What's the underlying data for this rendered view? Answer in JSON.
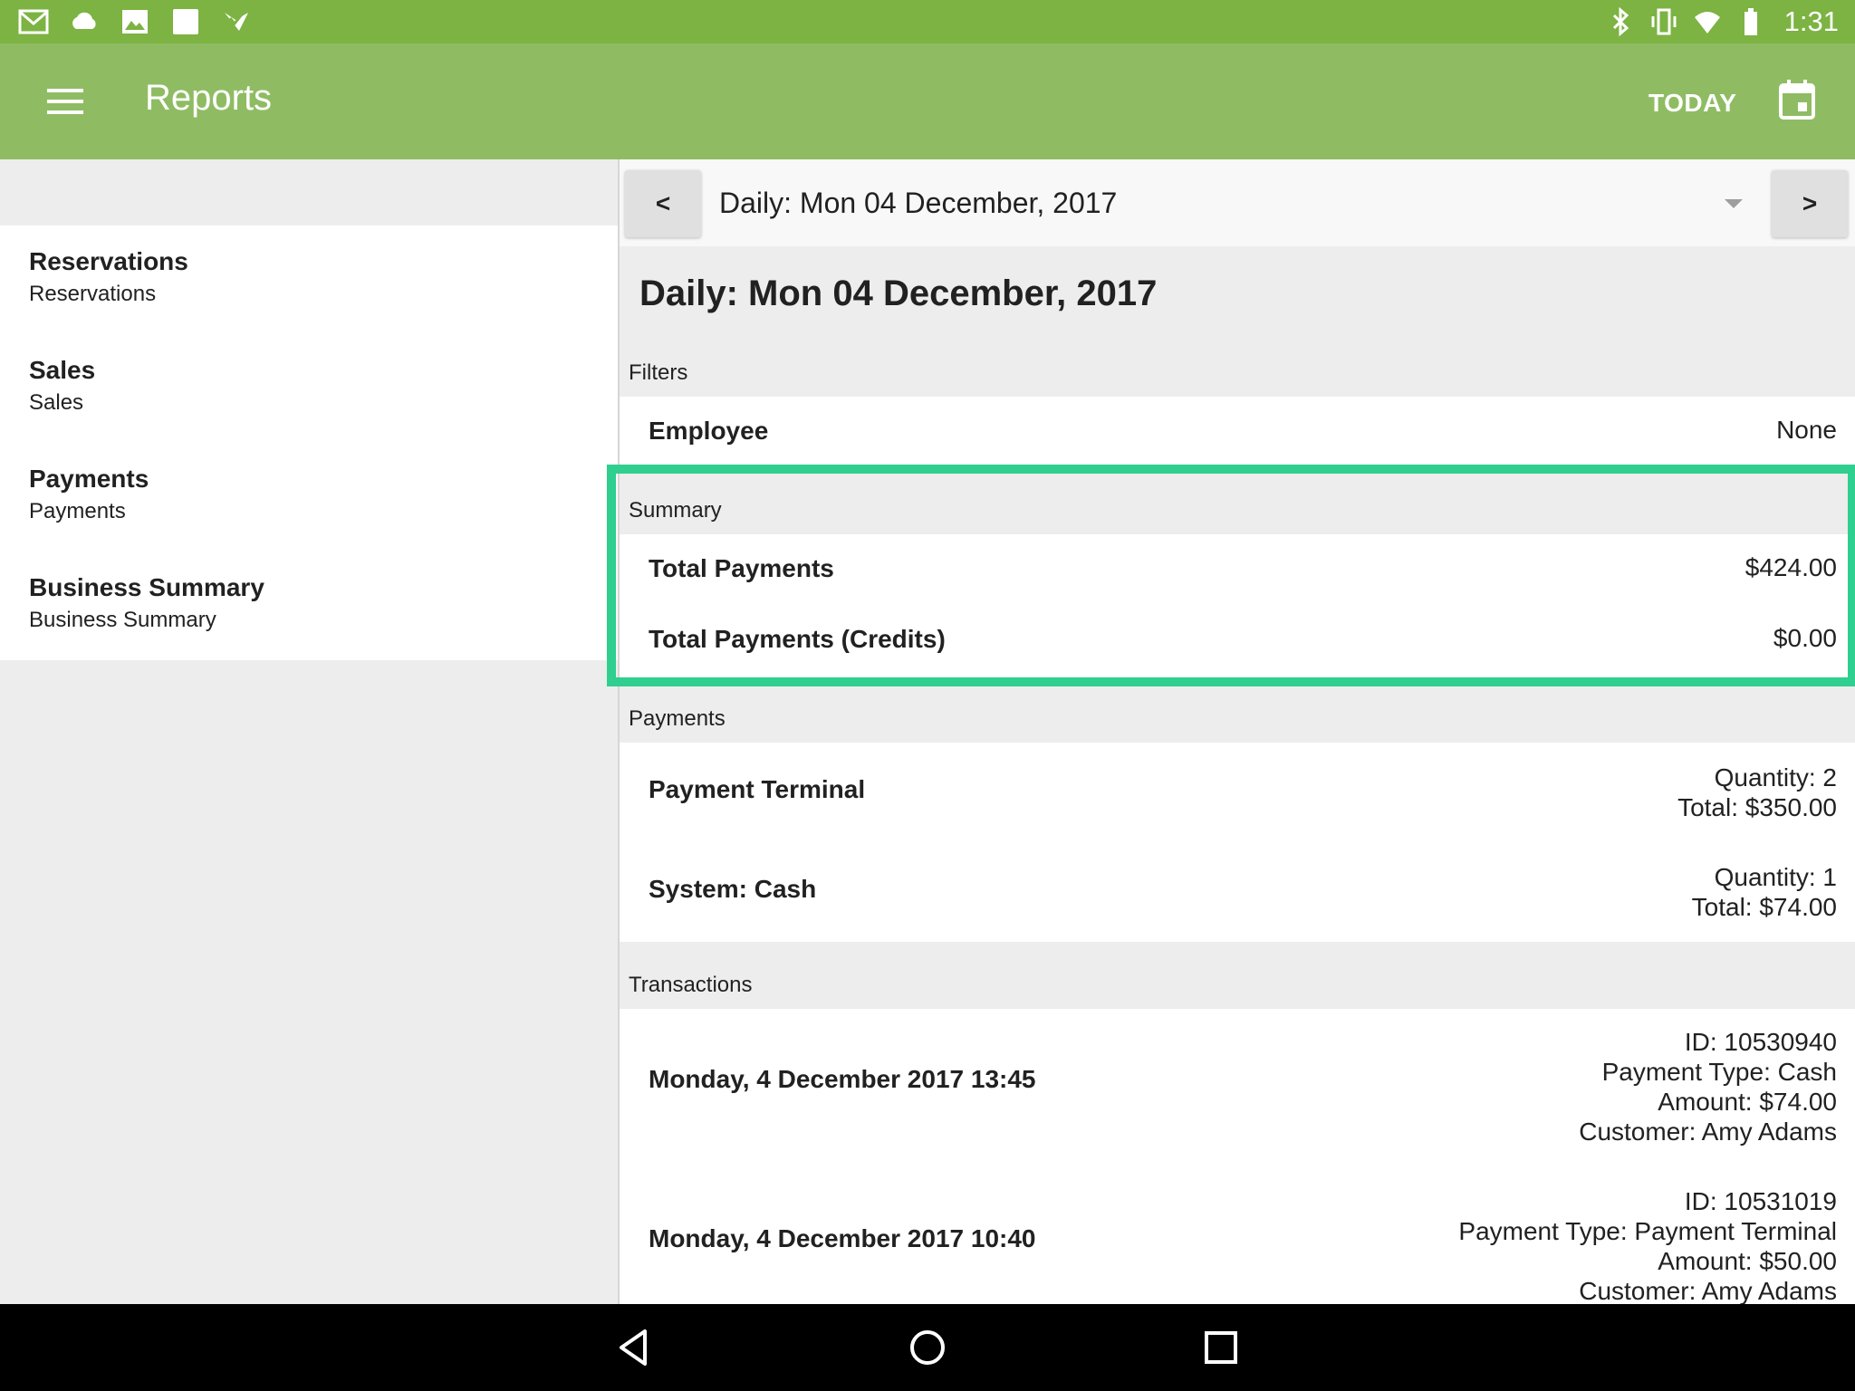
{
  "status_bar": {
    "time": "1:31",
    "left_icons": [
      "gmail-icon",
      "cloud-icon",
      "photo-icon",
      "blank-app-icon",
      "play-games-icon"
    ],
    "right_icons": [
      "bluetooth-icon",
      "vibrate-icon",
      "wifi-icon",
      "battery-icon"
    ]
  },
  "app_bar": {
    "title": "Reports",
    "today_label": "TODAY",
    "colors": {
      "status_bar": "#7cb342",
      "app_bar": "#8fbc63",
      "highlight": "#2ecf8f"
    }
  },
  "sidebar": {
    "items": [
      {
        "title": "Reservations",
        "subtitle": "Reservations"
      },
      {
        "title": "Sales",
        "subtitle": "Sales"
      },
      {
        "title": "Payments",
        "subtitle": "Payments"
      },
      {
        "title": "Business Summary",
        "subtitle": "Business Summary"
      }
    ]
  },
  "date_bar": {
    "prev_label": "<",
    "next_label": ">",
    "selected": "Daily: Mon 04 December, 2017"
  },
  "report": {
    "title": "Daily: Mon 04 December, 2017",
    "filters": {
      "label": "Filters",
      "employee_label": "Employee",
      "employee_value": "None"
    },
    "summary": {
      "label": "Summary",
      "rows": [
        {
          "label": "Total Payments",
          "value": "$424.00"
        },
        {
          "label": "Total Payments (Credits)",
          "value": "$0.00"
        }
      ]
    },
    "payments": {
      "label": "Payments",
      "rows": [
        {
          "label": "Payment Terminal",
          "line1": "Quantity: 2",
          "line2": "Total: $350.00"
        },
        {
          "label": "System: Cash",
          "line1": "Quantity: 1",
          "line2": "Total: $74.00"
        }
      ]
    },
    "transactions": {
      "label": "Transactions",
      "rows": [
        {
          "label": "Monday, 4 December 2017 13:45",
          "id": "ID: 10530940",
          "type": "Payment Type: Cash",
          "amount": "Amount: $74.00",
          "customer": "Customer: Amy Adams"
        },
        {
          "label": "Monday, 4 December 2017 10:40",
          "id": "ID: 10531019",
          "type": "Payment Type: Payment Terminal",
          "amount": "Amount: $50.00",
          "customer": "Customer: Amy Adams"
        }
      ]
    }
  }
}
